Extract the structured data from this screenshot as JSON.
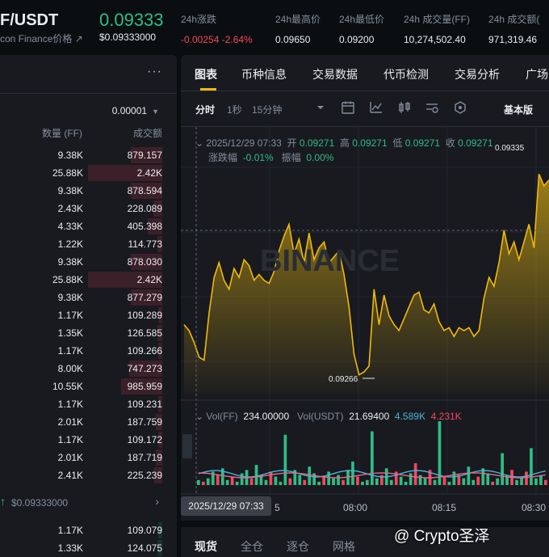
{
  "header": {
    "pair": "F/USDT",
    "pair_sub": "con Finance价格 ↗",
    "last_price": "0.09333",
    "last_price_usd": "$0.09333000",
    "stats": [
      {
        "label": "24h涨跌",
        "value": "-0.00254 -2.64%"
      },
      {
        "label": "24h最高价",
        "value": "0.09650"
      },
      {
        "label": "24h最低价",
        "value": "0.09200"
      },
      {
        "label": "24h 成交量(FF)",
        "value": "10,274,502.40"
      },
      {
        "label": "24h 成交额(",
        "value": "971,319.46"
      }
    ]
  },
  "orderbook": {
    "more": "···",
    "tick": "0.00001",
    "col_qty": "数量 (FF)",
    "col_total": "成交额",
    "asks": [
      {
        "qty": "9.38K",
        "total": "879.157",
        "depth": 0.42
      },
      {
        "qty": "25.88K",
        "total": "2.42K",
        "depth": 1.0
      },
      {
        "qty": "9.38K",
        "total": "878.594",
        "depth": 0.42
      },
      {
        "qty": "2.43K",
        "total": "228.089",
        "depth": 0.12
      },
      {
        "qty": "4.33K",
        "total": "405.398",
        "depth": 0.2
      },
      {
        "qty": "1.22K",
        "total": "114.773",
        "depth": 0.06
      },
      {
        "qty": "9.38K",
        "total": "878.030",
        "depth": 0.42
      },
      {
        "qty": "25.88K",
        "total": "2.42K",
        "depth": 1.0
      },
      {
        "qty": "9.38K",
        "total": "877.279",
        "depth": 0.42
      },
      {
        "qty": "1.17K",
        "total": "109.289",
        "depth": 0.05
      },
      {
        "qty": "1.35K",
        "total": "126.585",
        "depth": 0.06
      },
      {
        "qty": "1.17K",
        "total": "109.266",
        "depth": 0.05
      },
      {
        "qty": "8.00K",
        "total": "747.273",
        "depth": 0.45
      },
      {
        "qty": "10.55K",
        "total": "985.959",
        "depth": 0.55
      },
      {
        "qty": "1.17K",
        "total": "109.231",
        "depth": 0.05
      },
      {
        "qty": "2.01K",
        "total": "187.759",
        "depth": 0.09
      },
      {
        "qty": "1.17K",
        "total": "109.172",
        "depth": 0.05
      },
      {
        "qty": "2.01K",
        "total": "187.719",
        "depth": 0.09
      },
      {
        "qty": "2.41K",
        "total": "225.239",
        "depth": 0.11
      }
    ],
    "mid_arrow": "↑",
    "mid_price": "$0.09333000",
    "mid_chevron": "›",
    "bids": [
      {
        "qty": "1.17K",
        "total": "109.079",
        "depth": 0.05
      },
      {
        "qty": "1.33K",
        "total": "124.075",
        "depth": 0.06
      }
    ]
  },
  "chart_tabs": [
    "图表",
    "币种信息",
    "交易数据",
    "代币检测",
    "交易分析",
    "广场"
  ],
  "toolbar": {
    "intervals": [
      "分时",
      "1秒",
      "15分钟"
    ],
    "mode": "基本版"
  },
  "ohlc": {
    "date": "2025/12/29 07:33",
    "open_label": "开",
    "open": "0.09271",
    "high_label": "高",
    "high": "0.09271",
    "low_label": "低",
    "low": "0.09271",
    "close_label": "收",
    "close": "0.09271",
    "change_label": "涨跌幅",
    "change": "-0.01%",
    "amp_label": "振幅",
    "amp": "0.00%"
  },
  "volume": {
    "vol_ff_label": "Vol(FF)",
    "vol_ff": "234.00000",
    "vol_usdt_label": "Vol(USDT)",
    "vol_usdt": "21.69400",
    "ma1": "4.589K",
    "ma2": "4.231K"
  },
  "price_labels": {
    "high": "0.09335",
    "low": "0.09266"
  },
  "time_axis": {
    "cursor": "2025/12/29 07:33",
    "ticks": [
      "5",
      "08:00",
      "08:15",
      "08:30"
    ]
  },
  "bottom_tabs": [
    "现货",
    "全仓",
    "逐仓",
    "网格"
  ],
  "watermark": "@ Crypto圣泽",
  "chart_data": {
    "type": "area",
    "x_ticks": [
      "08:00",
      "08:15",
      "08:30"
    ],
    "series": [
      {
        "values": [
          0.09284,
          0.09282,
          0.09278,
          0.09273,
          0.09272,
          0.09288,
          0.093,
          0.09305,
          0.09299,
          0.09296,
          0.09303,
          0.093,
          0.09306,
          0.09304,
          0.09299,
          0.09301,
          0.09299,
          0.09298,
          0.09302,
          0.09309,
          0.09314,
          0.09318,
          0.09308,
          0.09313,
          0.09305,
          0.09315,
          0.09306,
          0.0931,
          0.09312,
          0.09305,
          0.09307,
          0.09309,
          0.09301,
          0.0929,
          0.09274,
          0.09267,
          0.09268,
          0.0927,
          0.09296,
          0.09284,
          0.09294,
          0.09287,
          0.09284,
          0.09282,
          0.09286,
          0.0929,
          0.09294,
          0.09295,
          0.09289,
          0.09288,
          0.09291,
          0.09285,
          0.09282,
          0.09283,
          0.0928,
          0.09283,
          0.09282,
          0.09283,
          0.0928,
          0.09282,
          0.09293,
          0.093,
          0.09297,
          0.09305,
          0.09316,
          0.09308,
          0.09312,
          0.09306,
          0.09312,
          0.09318,
          0.0931,
          0.09335,
          0.09331,
          0.09333
        ]
      }
    ],
    "volume": [
      3,
      2,
      4,
      8,
      6,
      10,
      3,
      5,
      2,
      7,
      9,
      4,
      12,
      6,
      3,
      8,
      5,
      2,
      30,
      4,
      9,
      6,
      3,
      11,
      7,
      2,
      5,
      8,
      4,
      6,
      3,
      9,
      14,
      5,
      2,
      3,
      32,
      4,
      6,
      10,
      3,
      8,
      5,
      2,
      7,
      13,
      6,
      4,
      9,
      3,
      38,
      5,
      2,
      8,
      6,
      4,
      11,
      3,
      5,
      10,
      7,
      2,
      4,
      19,
      6,
      9,
      3,
      5,
      8,
      22,
      4,
      6,
      3
    ],
    "volume_up": [
      true,
      false,
      true,
      true,
      false,
      true,
      true,
      false,
      true,
      true,
      true,
      false,
      true,
      true,
      true,
      false,
      true,
      true,
      true,
      false,
      true,
      true,
      false,
      true,
      true,
      true,
      false,
      true,
      true,
      true,
      false,
      true,
      true,
      false,
      true,
      true,
      true,
      true,
      false,
      true,
      true,
      false,
      true,
      true,
      true,
      false,
      true,
      true,
      false,
      true,
      true,
      false,
      true,
      true,
      false,
      true,
      true,
      true,
      false,
      true,
      true,
      false,
      true,
      true,
      true,
      false,
      true,
      true,
      false,
      true,
      true,
      true,
      false
    ]
  }
}
